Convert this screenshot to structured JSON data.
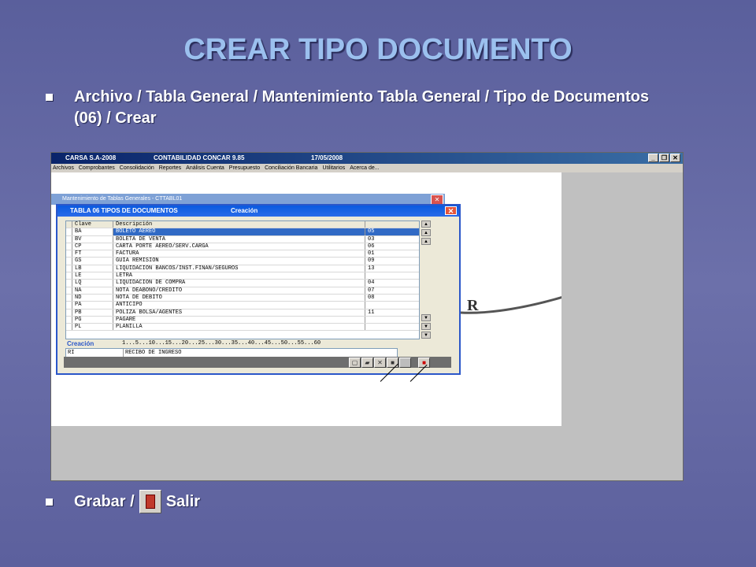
{
  "slide": {
    "title": "CREAR TIPO DOCUMENTO",
    "bullet1": "Archivo / Tabla General / Mantenimiento Tabla General / Tipo de Documentos (06) / Crear",
    "bullet2_before": "Grabar /",
    "bullet2_after": "Salir"
  },
  "app": {
    "title_company": "CARSA S.A-2008",
    "title_product": "CONTABILIDAD CONCAR 9.85",
    "title_date": "17/05/2008",
    "menu": [
      "Archivos",
      "Comprobantes",
      "Consolidación",
      "Reportes",
      "Análisis Cuenta",
      "Presupuesto",
      "Conciliación Bancaria",
      "Utilitarios",
      "Acerca de..."
    ],
    "outer_window_title": "Mantenimiento de Tablas Generales - CTTABL01"
  },
  "dialog": {
    "title": "TABLA 06 TIPOS DE DOCUMENTOS",
    "mode": "Creación",
    "columns": [
      "Clave",
      "Descripción"
    ],
    "rows": [
      {
        "clave": "BA",
        "desc": "BOLETO AEREO",
        "num": "05"
      },
      {
        "clave": "BV",
        "desc": "BOLETA DE VENTA",
        "num": "03"
      },
      {
        "clave": "CP",
        "desc": "CARTA PORTE AEREO/SERV.CARGA",
        "num": "06"
      },
      {
        "clave": "FT",
        "desc": "FACTURA",
        "num": "01"
      },
      {
        "clave": "GS",
        "desc": "GUIA REMISION",
        "num": "09"
      },
      {
        "clave": "LB",
        "desc": "LIQUIDACION BANCOS/INST.FINAN/SEGUROS",
        "num": "13"
      },
      {
        "clave": "LE",
        "desc": "LETRA",
        "num": ""
      },
      {
        "clave": "LQ",
        "desc": "LIQUIDACION DE COMPRA",
        "num": "04"
      },
      {
        "clave": "NA",
        "desc": "NOTA DEABONO/CREDITO",
        "num": "07"
      },
      {
        "clave": "ND",
        "desc": "NOTA DE DEBITO",
        "num": "08"
      },
      {
        "clave": "PA",
        "desc": "ANTICIPO",
        "num": ""
      },
      {
        "clave": "PB",
        "desc": "POLIZA BOLSA/AGENTES",
        "num": "11"
      },
      {
        "clave": "PG",
        "desc": "PAGARE",
        "num": ""
      },
      {
        "clave": "PL",
        "desc": "PLANILLA",
        "num": ""
      }
    ],
    "edit_label": "Creación",
    "ruler": "1...5...10...15...20...25...30...35...40...45...50...55...60",
    "edit_clave": "RI",
    "edit_desc": "RECIBO DE INGRESO"
  }
}
